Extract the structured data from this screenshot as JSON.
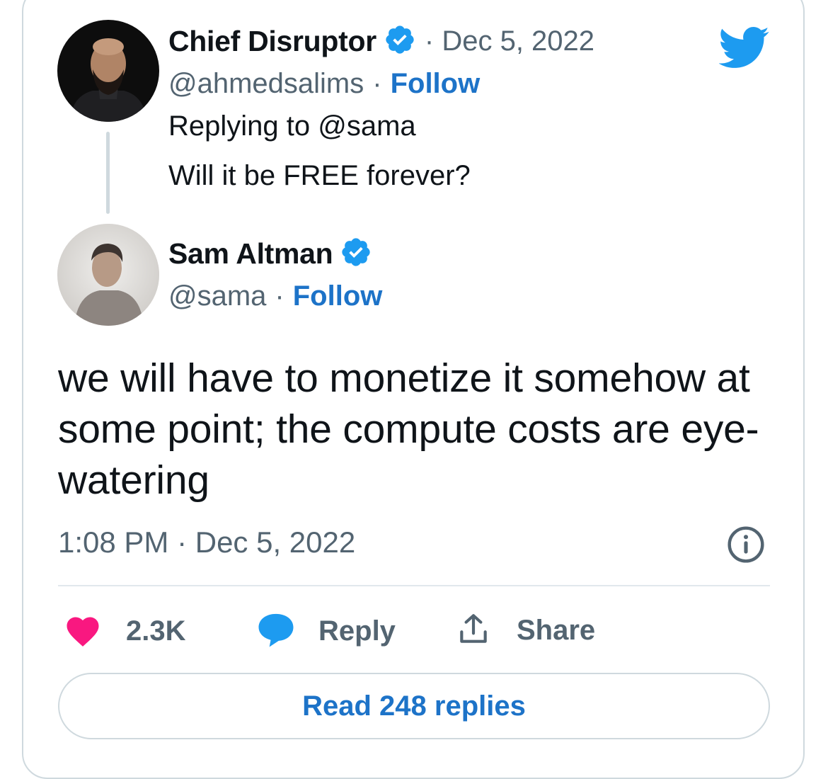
{
  "parent_tweet": {
    "author_name": "Chief Disruptor",
    "date": "· Dec 5, 2022",
    "handle": "@ahmedsalims",
    "separator": "·",
    "follow_label": "Follow",
    "replying_to": "Replying to @sama",
    "text": "Will it be FREE forever?"
  },
  "main_tweet": {
    "author_name": "Sam Altman",
    "handle": "@sama",
    "separator": "·",
    "follow_label": "Follow",
    "text": "we will have to monetize it somehow at some point; the compute costs are eye-watering",
    "timestamp": "1:08 PM · Dec 5, 2022"
  },
  "actions": {
    "like_count": "2.3K",
    "reply_label": "Reply",
    "share_label": "Share"
  },
  "read_replies_label": "Read 248 replies",
  "colors": {
    "follow_blue": "#1d73c8",
    "verified_blue": "#1d9bf0",
    "like_pink": "#f91880",
    "muted_gray": "#536471",
    "border": "#cfd9de"
  },
  "icons": [
    "twitter-bird-icon",
    "verified-badge-icon",
    "heart-icon",
    "reply-bubble-icon",
    "share-icon",
    "info-icon"
  ]
}
